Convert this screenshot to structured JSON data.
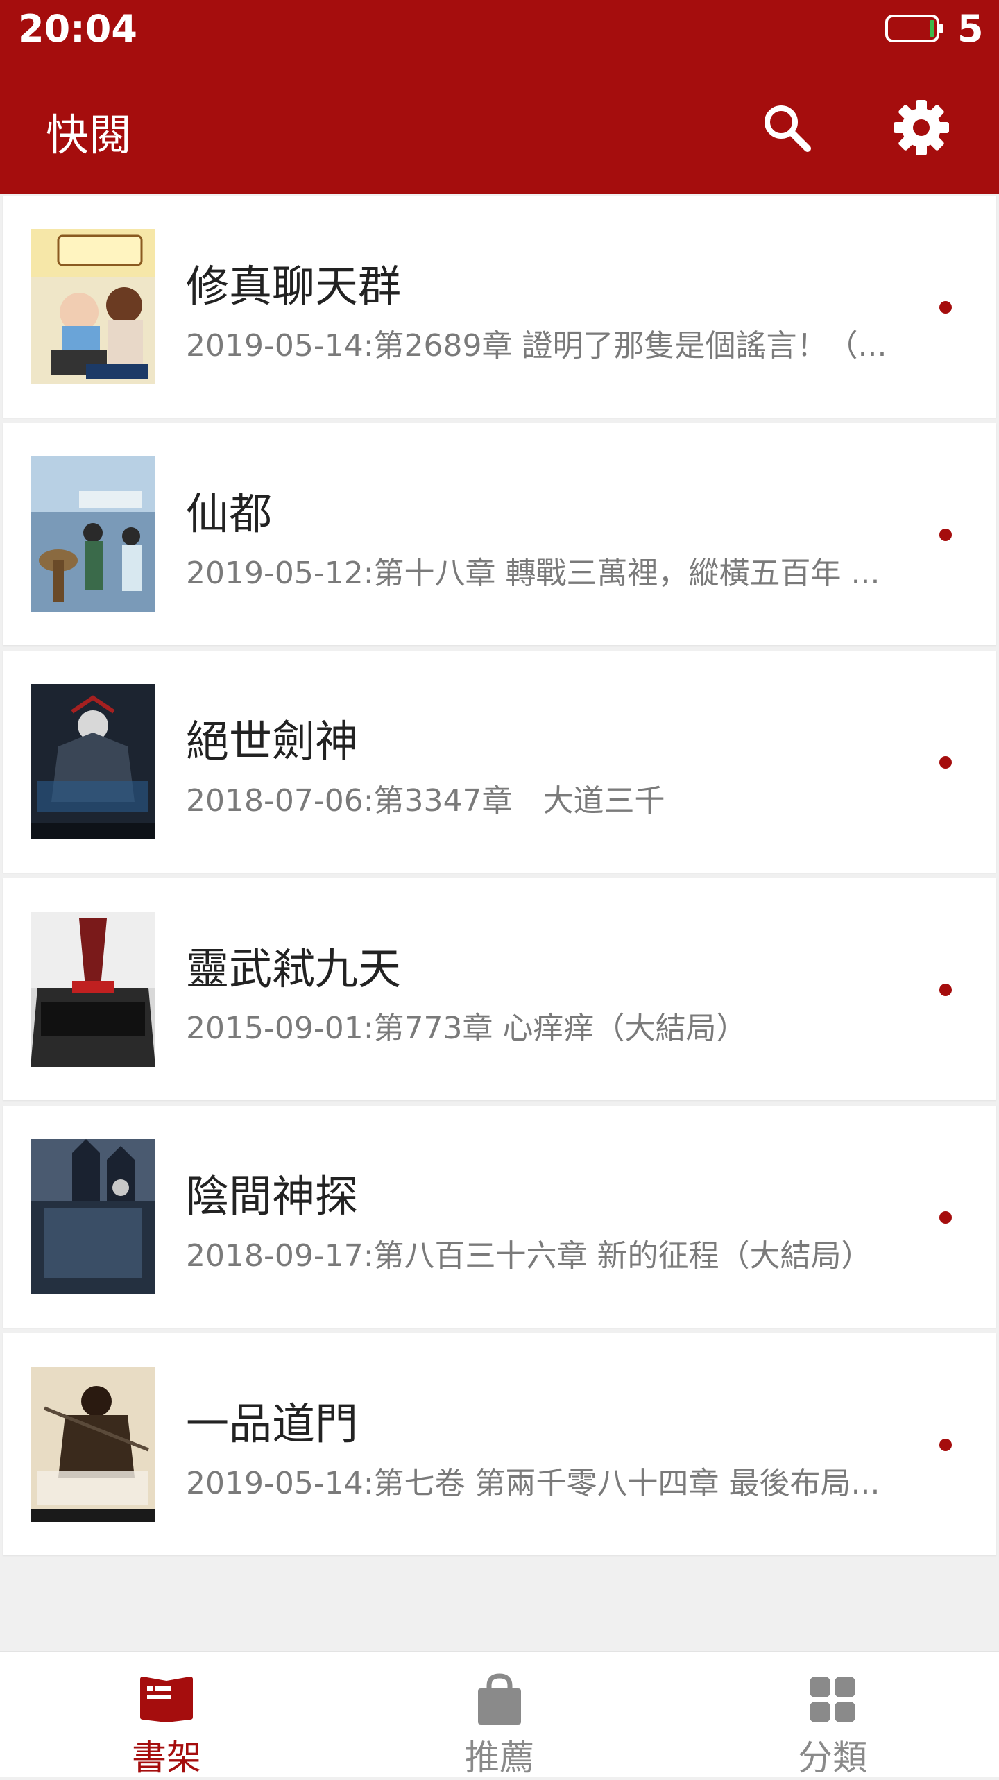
{
  "status_bar": {
    "time": "20:04",
    "battery_level": "5"
  },
  "app_bar": {
    "title": "快閱",
    "search_icon": "search-icon",
    "settings_icon": "gear-icon"
  },
  "books": [
    {
      "title": "修真聊天群",
      "update": "2019-05-14:第2689章 證明了那隻是個謠言！（..."
    },
    {
      "title": "仙都",
      "update": "2019-05-12:第十八章 轉戰三萬裡，縱橫五百年 ..."
    },
    {
      "title": "絕世劍神",
      "update": "2018-07-06:第3347章　大道三千"
    },
    {
      "title": "靈武弒九天",
      "update": "2015-09-01:第773章 心痒痒（大結局）"
    },
    {
      "title": "陰間神探",
      "update": "2018-09-17:第八百三十六章 新的征程（大結局）"
    },
    {
      "title": "一品道門",
      "update": "2019-05-14:第七卷 第兩千零八十四章 最後布局..."
    }
  ],
  "bottom_nav": {
    "items": [
      {
        "label": "書架",
        "icon": "book-icon",
        "active": true
      },
      {
        "label": "推薦",
        "icon": "bag-icon",
        "active": false
      },
      {
        "label": "分類",
        "icon": "grid-icon",
        "active": false
      }
    ]
  },
  "colors": {
    "accent": "#a50d0d",
    "unread_dot": "#a50d0d",
    "inactive_nav": "#8a8a8a"
  }
}
